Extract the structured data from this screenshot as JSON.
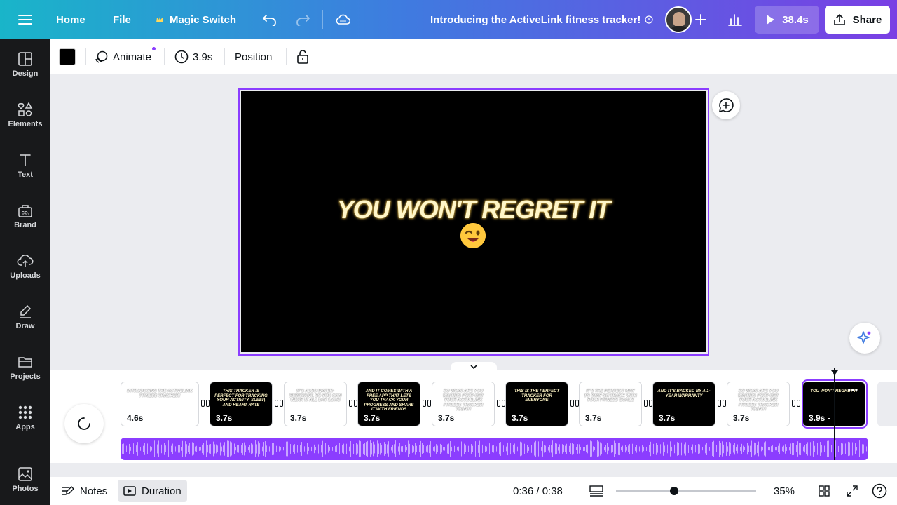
{
  "topbar": {
    "home": "Home",
    "file": "File",
    "magic_switch": "Magic Switch",
    "title": "Introducing the ActiveLink fitness tracker!",
    "play_duration": "38.4s",
    "share": "Share"
  },
  "sidebar": {
    "items": [
      {
        "label": "Design",
        "icon": "design-icon"
      },
      {
        "label": "Elements",
        "icon": "elements-icon"
      },
      {
        "label": "Text",
        "icon": "text-icon"
      },
      {
        "label": "Brand",
        "icon": "brand-icon"
      },
      {
        "label": "Uploads",
        "icon": "uploads-icon"
      },
      {
        "label": "Draw",
        "icon": "draw-icon"
      },
      {
        "label": "Projects",
        "icon": "projects-icon"
      },
      {
        "label": "Apps",
        "icon": "apps-icon"
      },
      {
        "label": "Photos",
        "icon": "photos-icon"
      }
    ]
  },
  "toolbar": {
    "color": "#000000",
    "animate": "Animate",
    "duration": "3.9s",
    "position": "Position"
  },
  "canvas": {
    "headline": "YOU WON'T REGRET IT",
    "emoji": "winking-face-emoji"
  },
  "timeline": {
    "scenes": [
      {
        "text": "INTRODUCING THE ACTIVELINK FITNESS TRACKER!",
        "duration": "4.6s",
        "theme": "light"
      },
      {
        "text": "THIS TRACKER IS PERFECT FOR TRACKING YOUR ACTIVITY, SLEEP, AND HEART RATE",
        "duration": "3.7s",
        "theme": "dark"
      },
      {
        "text": "IT'S ALSO WATER-RESISTANT, SO YOU CAN WEAR IT ALL DAY LONG",
        "duration": "3.7s",
        "theme": "light"
      },
      {
        "text": "AND IT COMES WITH A FREE APP THAT LETS YOU TRACK YOUR PROGRESS AND SHARE IT WITH FRIENDS",
        "duration": "3.7s",
        "theme": "dark"
      },
      {
        "text": "SO WHAT ARE YOU WAITING FOR? GET YOUR ACTIVELINK FITNESS TRACKER TODAY!",
        "duration": "3.7s",
        "theme": "light"
      },
      {
        "text": "THIS IS THE PERFECT TRACKER FOR EVERYONE",
        "duration": "3.7s",
        "theme": "dark"
      },
      {
        "text": "IT'S THE PERFECT WAY TO STAY ON TRACK WITH YOUR FITNESS GOALS",
        "duration": "3.7s",
        "theme": "light"
      },
      {
        "text": "AND IT'S BACKED BY A 1-YEAR WARRANTY",
        "duration": "3.7s",
        "theme": "dark"
      },
      {
        "text": "SO WHAT ARE YOU WAITING FOR? GET YOUR ACTIVELINK FITNESS TRACKER TODAY!",
        "duration": "3.7s",
        "theme": "light"
      },
      {
        "text": "YOU WON'T REGRET IT",
        "duration": "3.9s -",
        "theme": "dark"
      }
    ]
  },
  "bottombar": {
    "notes": "Notes",
    "duration": "Duration",
    "time": "0:36 / 0:38",
    "zoom": "35%",
    "zoom_level": 0.35
  },
  "colors": {
    "accent": "#8b3dff",
    "sidebar_bg": "#18191b"
  }
}
